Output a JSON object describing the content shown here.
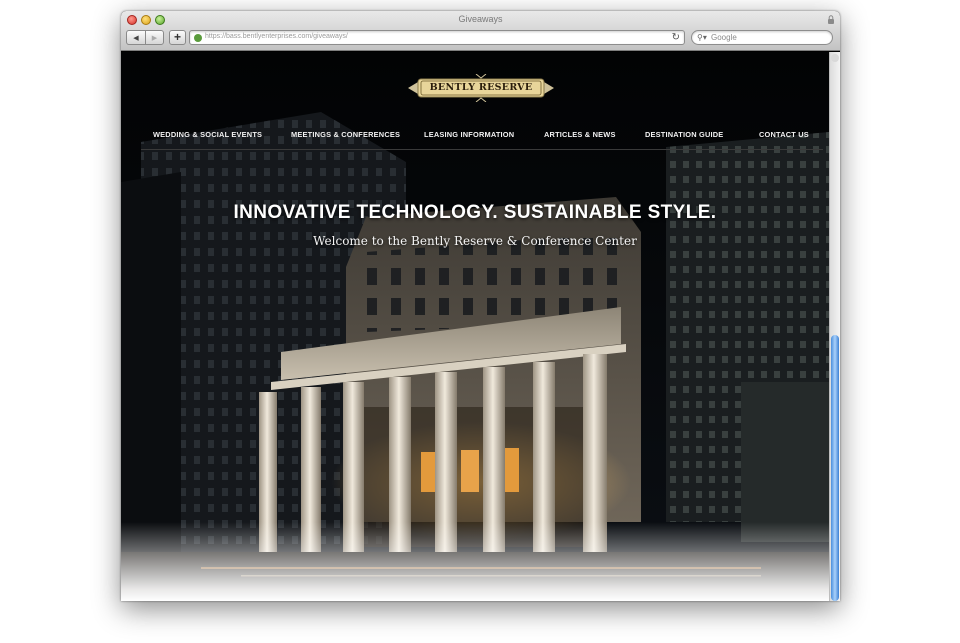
{
  "browser": {
    "title": "Giveaways",
    "url": "https://bass.bentlyenterprises.com/giveaways/",
    "search_placeholder": "Google",
    "back_glyph": "◀",
    "forward_glyph": "▶",
    "add_glyph": "+",
    "reload_glyph": "↻",
    "search_glyph": "⚲▾"
  },
  "site": {
    "logo_text": "BENTLY RESERVE",
    "nav": [
      {
        "label": "WEDDING & SOCIAL EVENTS"
      },
      {
        "label": "MEETINGS & CONFERENCES"
      },
      {
        "label": "LEASING INFORMATION"
      },
      {
        "label": "ARTICLES & NEWS"
      },
      {
        "label": "DESTINATION GUIDE"
      },
      {
        "label": "CONTACT US"
      }
    ],
    "headline": "INNOVATIVE TECHNOLOGY. SUSTAINABLE STYLE.",
    "subheadline": "Welcome to the Bently Reserve & Conference Center"
  },
  "colors": {
    "logo_gold": "#e8d59a",
    "nav_text": "#f2f2f2",
    "scroll_thumb": "#4b8fdc"
  }
}
